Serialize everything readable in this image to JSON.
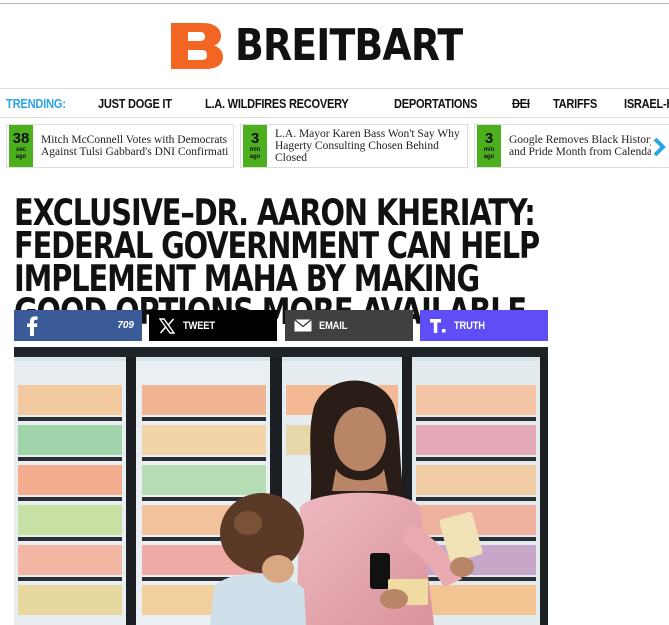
{
  "logo": {
    "text": "BREITBART",
    "brand_color": "#f26522"
  },
  "trending": {
    "label": "TRENDING:",
    "items": [
      {
        "label": "JUST DOGE IT",
        "strike": false
      },
      {
        "label": "L.A. WILDFIRES RECOVERY",
        "strike": false
      },
      {
        "label": "DEPORTATIONS",
        "strike": false
      },
      {
        "label": "DEI",
        "strike": true
      },
      {
        "label": "TARIFFS",
        "strike": false
      },
      {
        "label": "ISRAEL-HAMAS WAR",
        "strike": false
      }
    ]
  },
  "ticker": {
    "items": [
      {
        "age_num": "38",
        "age_unit_1": "sec",
        "age_unit_2": "ago",
        "text": "Mitch McConnell Votes with Democrats Against Tulsi Gabbard's DNI Confirmati"
      },
      {
        "age_num": "3",
        "age_unit_1": "min",
        "age_unit_2": "ago",
        "text": "L.A. Mayor Karen Bass Won't Say Why Hagerty Consulting Chosen Behind Closed"
      },
      {
        "age_num": "3",
        "age_unit_1": "min",
        "age_unit_2": "ago",
        "text": "Google Removes Black History and Pride Month from Calendar"
      }
    ],
    "next_icon": "chevron-right-icon"
  },
  "article": {
    "headline": "EXCLUSIVE–DR. AARON KHERIATY: FEDERAL GOVERNMENT CAN HELP IMPLEMENT MAHA BY MAKING GOOD OPTIONS MORE AVAILABLE"
  },
  "share": {
    "facebook": {
      "icon": "facebook-icon",
      "count": "709",
      "color": "#3b5a98"
    },
    "x": {
      "icon": "x-icon",
      "label": "TWEET",
      "color": "#000000"
    },
    "email": {
      "icon": "email-icon",
      "label": "EMAIL",
      "color": "#404040"
    },
    "truth": {
      "icon": "truth-social-icon",
      "label": "TRUTH",
      "color": "#5f4df5"
    }
  },
  "hero_image": {
    "subject": "photo-woman-child-frozen-aisle"
  }
}
